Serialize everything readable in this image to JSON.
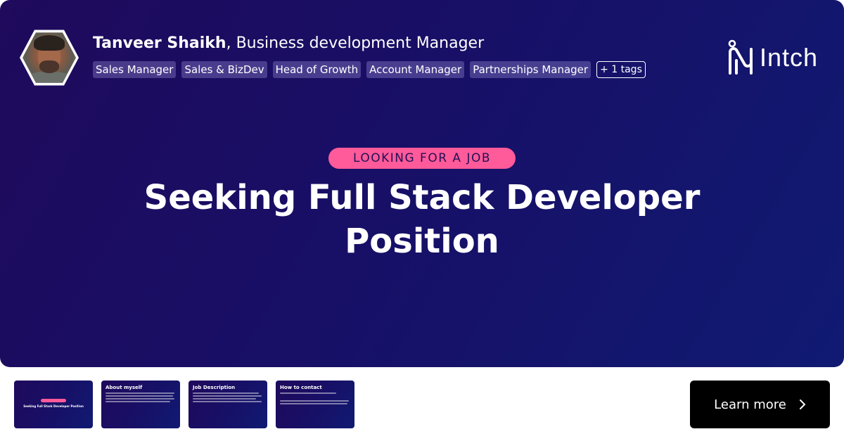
{
  "profile": {
    "name": "Tanveer Shaikh",
    "separator": ", ",
    "role": "Business development Manager",
    "tags": [
      "Sales Manager",
      "Sales & BizDev",
      "Head of Growth",
      "Account Manager",
      "Partnerships Manager"
    ],
    "more_tags": "+ 1 tags"
  },
  "brand": {
    "logo_text": "Intch",
    "logo_icon": "intch-logo-icon"
  },
  "post": {
    "badge": "LOOKING FOR A JOB",
    "title": "Seeking Full Stack Developer Position"
  },
  "thumbnails": [
    {
      "title": "Seeking Full Stack Developer Position"
    },
    {
      "title": "About myself"
    },
    {
      "title": "Job Description"
    },
    {
      "title": "How to contact"
    }
  ],
  "cta": {
    "label": "Learn more",
    "icon": "chevron-right-icon"
  },
  "colors": {
    "hero_start": "#1f0a5c",
    "hero_end": "#101a72",
    "badge_bg": "#ff5a9a",
    "cta_bg": "#000000"
  }
}
